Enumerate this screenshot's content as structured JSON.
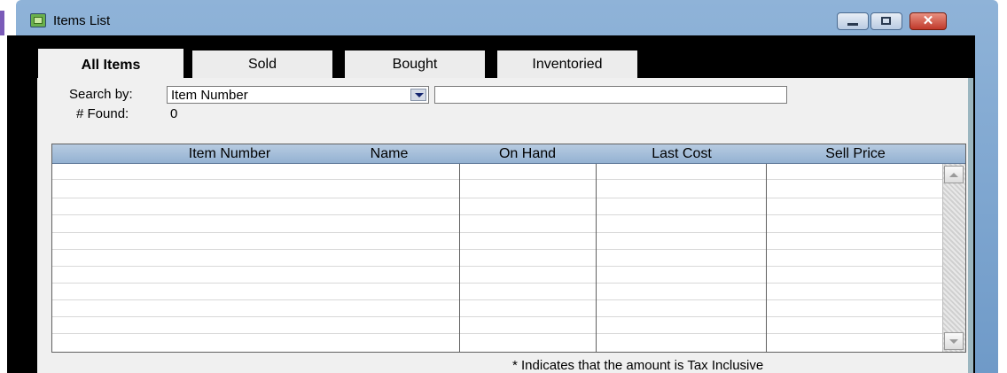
{
  "window": {
    "title": "Items List",
    "icon": "items-list-icon",
    "controls": {
      "minimize_icon": "minimize-icon",
      "maximize_icon": "maximize-icon",
      "close_label": "✕"
    }
  },
  "tabs": [
    {
      "label": "All Items",
      "active": true
    },
    {
      "label": "Sold",
      "active": false
    },
    {
      "label": "Bought",
      "active": false
    },
    {
      "label": "Inventoried",
      "active": false
    }
  ],
  "search": {
    "label": "Search by:",
    "by_value": "Item Number",
    "text_value": ""
  },
  "found": {
    "label": "# Found:",
    "value": "0"
  },
  "table": {
    "columns": [
      "Item Number",
      "Name",
      "On Hand",
      "Last Cost",
      "Sell Price"
    ],
    "rows": []
  },
  "footnote": "* Indicates that the amount is Tax Inclusive"
}
